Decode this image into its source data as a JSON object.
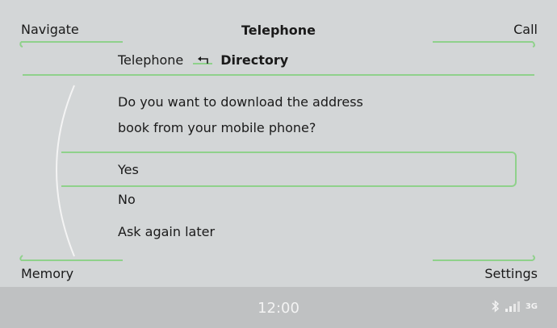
{
  "corners": {
    "navigate": "Navigate",
    "call": "Call",
    "memory": "Memory",
    "settings": "Settings"
  },
  "title": "Telephone",
  "breadcrumb": {
    "parent": "Telephone",
    "current": "Directory",
    "separator_icon": "back-arrow-icon"
  },
  "question": {
    "line1": "Do you want to download the address",
    "line2": "book from your mobile phone?"
  },
  "options": [
    {
      "label": "Yes",
      "selected": true
    },
    {
      "label": "No",
      "selected": false
    },
    {
      "label": "Ask again later",
      "selected": false
    }
  ],
  "status": {
    "clock": "12:00",
    "icons": [
      "bluetooth-icon",
      "signal-strength-icon",
      "network-3g-icon"
    ],
    "network_label": "3G"
  },
  "colors": {
    "accent": "#8fd18b",
    "background": "#d3d6d7",
    "statusbar": "#bfc1c2"
  }
}
